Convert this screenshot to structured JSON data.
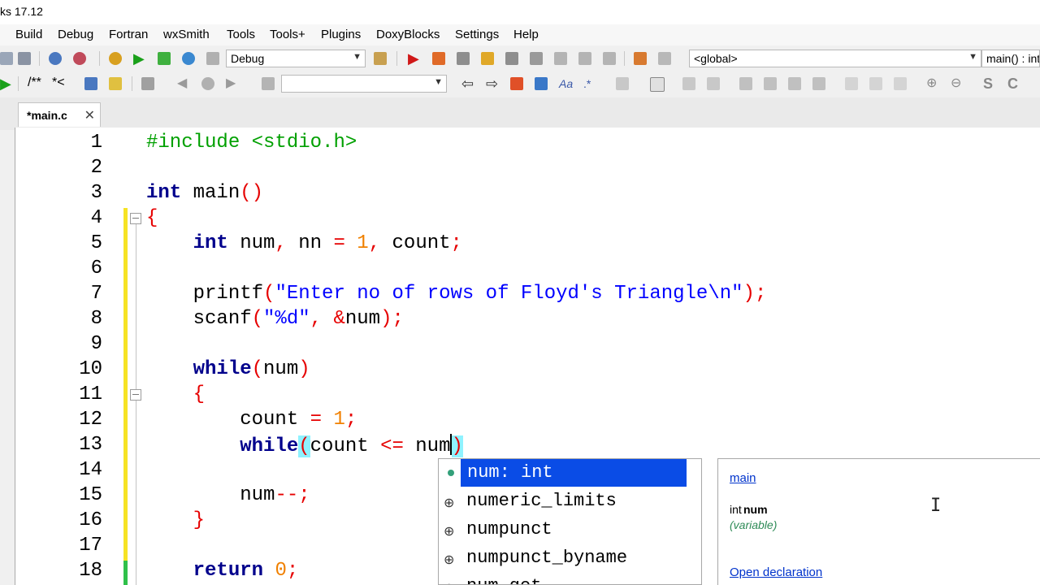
{
  "window": {
    "title": "ks 17.12"
  },
  "menu": [
    "Build",
    "Debug",
    "Fortran",
    "wxSmith",
    "Tools",
    "Tools+",
    "Plugins",
    "DoxyBlocks",
    "Settings",
    "Help"
  ],
  "toolbar": {
    "build_target": "Debug",
    "scope": "<global>",
    "function": "main() : int",
    "comment_a": "/**",
    "comment_b": "*<"
  },
  "tab": {
    "label": "*main.c",
    "close": "✕"
  },
  "editor": {
    "line_numbers": [
      "1",
      "2",
      "3",
      "4",
      "5",
      "6",
      "7",
      "8",
      "9",
      "10",
      "11",
      "12",
      "13",
      "14",
      "15",
      "16",
      "17",
      "18"
    ],
    "lines": [
      "#include <stdio.h>",
      "",
      "int main()",
      "{",
      "    int num, nn = 1, count;",
      "",
      "    printf(\"Enter no of rows of Floyd's Triangle\\n\");",
      "    scanf(\"%d\", &num);",
      "",
      "    while(num)",
      "    {",
      "        count = 1;",
      "        while(count <= num)",
      "",
      "        num--;",
      "    }",
      "",
      "    return 0;"
    ]
  },
  "autocomplete": {
    "items": [
      {
        "label": "num: int",
        "icon": "variable-icon"
      },
      {
        "label": "numeric_limits",
        "icon": "class-icon"
      },
      {
        "label": "numpunct",
        "icon": "class-icon"
      },
      {
        "label": "numpunct_byname",
        "icon": "class-icon"
      },
      {
        "label": "num_get",
        "icon": "class-icon"
      }
    ]
  },
  "doc_popup": {
    "scope_link": "main",
    "decl_type": "int",
    "decl_name": "num",
    "kind": "(variable)",
    "open_link": "Open declaration"
  },
  "colors": {
    "keyword": "#00008c",
    "string": "#0000ff",
    "number": "#f08000",
    "operator": "#e60000",
    "preprocessor": "#00a000",
    "selection": "#0a4ce6"
  }
}
